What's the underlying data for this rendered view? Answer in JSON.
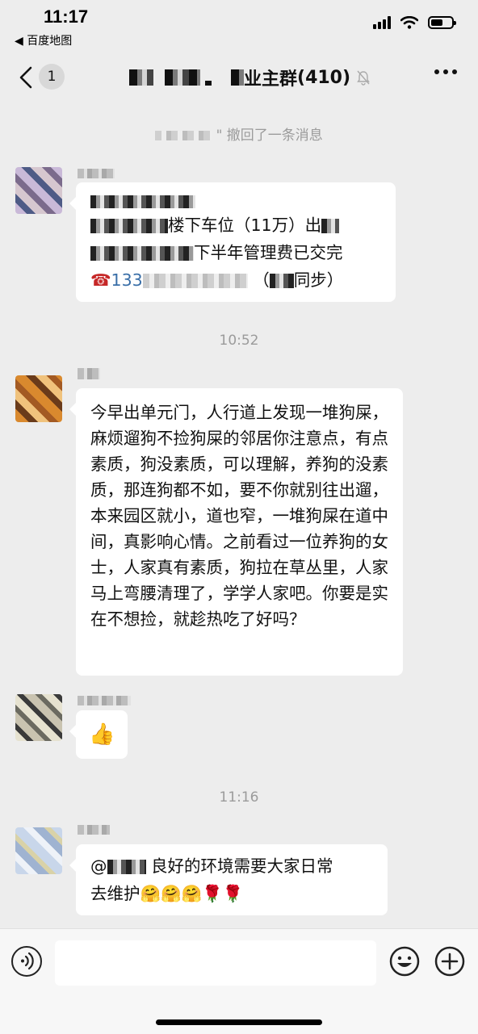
{
  "status_bar": {
    "time": "11:17",
    "back_app": "◀ 百度地图"
  },
  "nav": {
    "back_count": "1",
    "title_visible": "业主群",
    "member_count": "(410)"
  },
  "messages": [
    {
      "type": "system",
      "text": "\" 撤回了一条消息"
    },
    {
      "type": "text",
      "lines": [
        "楼下车位（11万）出",
        "下半年管理费已交完",
        "133",
        "（",
        "同步）"
      ]
    },
    {
      "type": "time",
      "text": "10:52"
    },
    {
      "type": "text",
      "text": "今早出单元门，人行道上发现一堆狗屎，麻烦遛狗不捡狗屎的邻居你注意点，有点素质，狗没素质，可以理解，养狗的没素质，那连狗都不如，要不你就别往出遛，本来园区就小，道也窄，一堆狗屎在道中间，真影响心情。之前看过一位养狗的女士，人家真有素质，狗拉在草丛里，人家马上弯腰清理了，学学人家吧。你要是实在不想捡，就趁热吃了好吗？"
    },
    {
      "type": "emoji",
      "text": "👍"
    },
    {
      "type": "time",
      "text": "11:16"
    },
    {
      "type": "text",
      "line1_prefix": "@",
      "line1": "良好的环境需要大家日常",
      "line2": "去维护",
      "emoji": "🤗🤗🤗🌹🌹"
    }
  ],
  "icons": {
    "status": [
      "signal-icon",
      "wifi-icon",
      "battery-icon"
    ],
    "nav": [
      "back-chevron-icon",
      "mute-bell-icon",
      "more-dots-icon"
    ],
    "input": [
      "voice-icon",
      "emoji-icon",
      "plus-icon"
    ],
    "inline": [
      "telephone-icon"
    ]
  },
  "colors": {
    "background": "#ededed",
    "bubble": "#ffffff",
    "system_text": "#9b9b9b"
  }
}
